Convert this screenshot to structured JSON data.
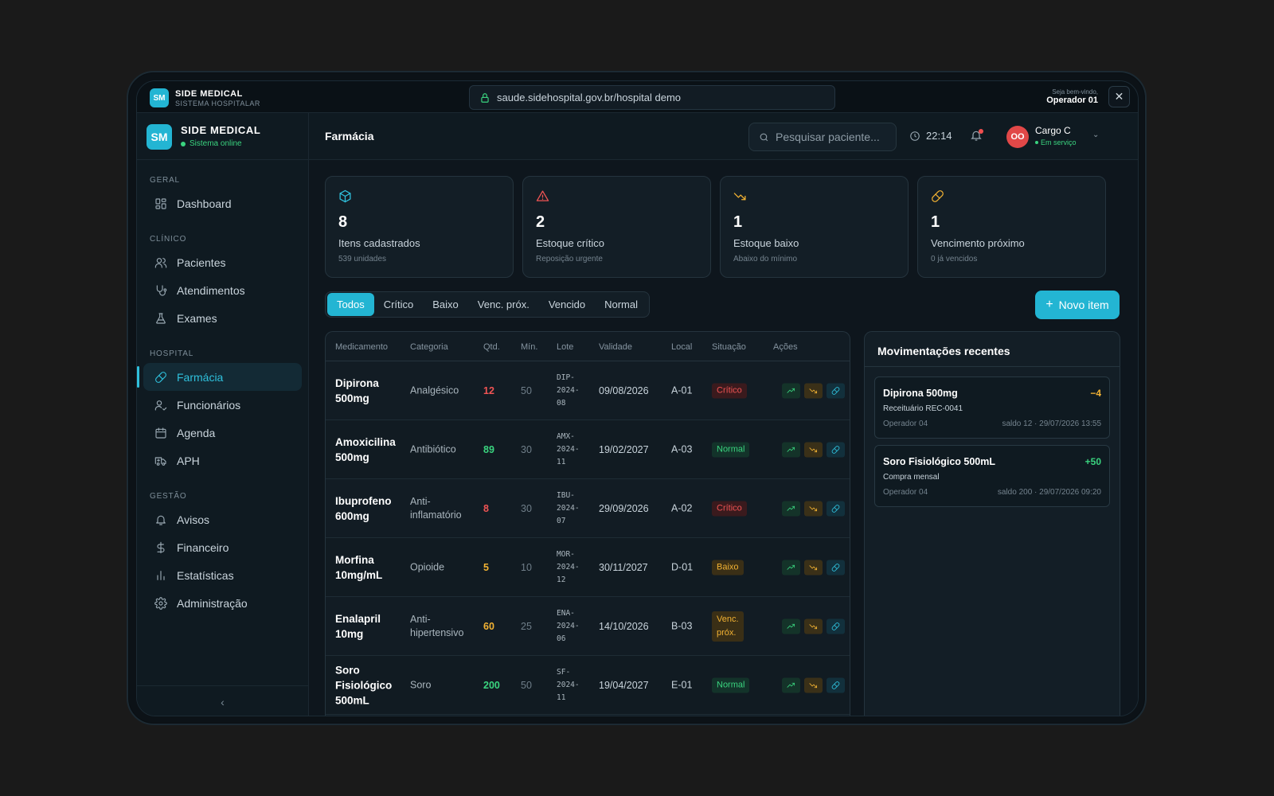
{
  "window": {
    "brand_name": "SIDE MEDICAL",
    "brand_sub": "SISTEMA HOSPITALAR",
    "logo": "SM",
    "url": "saude.sidehospital.gov.br/hospital demo",
    "welcome_label": "Seja bem-vindo,",
    "welcome_user": "Operador 01",
    "close_label": "✕"
  },
  "sidebar": {
    "logo": "SM",
    "brand": "SIDE MEDICAL",
    "status": "Sistema online",
    "collapse_label": "‹",
    "sections": {
      "geral": "GERAL",
      "clinico": "CLÍNICO",
      "hospital": "HOSPITAL",
      "gestao": "GESTÃO"
    },
    "items": {
      "dashboard": "Dashboard",
      "pacientes": "Pacientes",
      "atendimentos": "Atendimentos",
      "exames": "Exames",
      "farmacia": "Farmácia",
      "funcionarios": "Funcionários",
      "agenda": "Agenda",
      "aph": "APH",
      "avisos": "Avisos",
      "financeiro": "Financeiro",
      "estatisticas": "Estatísticas",
      "administracao": "Administração"
    },
    "active": "farmacia"
  },
  "header": {
    "title": "Farmácia",
    "search_placeholder": "Pesquisar paciente...",
    "time": "22:14",
    "avatar_initials": "OO",
    "user_name": "Cargo C",
    "user_status": "Em serviço"
  },
  "stats": [
    {
      "value": "8",
      "label": "Itens cadastrados",
      "sub": "539 unidades",
      "icon": "box-icon",
      "color": "#2fc0dc"
    },
    {
      "value": "2",
      "label": "Estoque crítico",
      "sub": "Reposição urgente",
      "icon": "alert-triangle-icon",
      "color": "#f05454"
    },
    {
      "value": "1",
      "label": "Estoque baixo",
      "sub": "Abaixo do mínimo",
      "icon": "trending-down-icon",
      "color": "#f2b233"
    },
    {
      "value": "1",
      "label": "Vencimento próximo",
      "sub": "0 já vencidos",
      "icon": "pill-icon",
      "color": "#f2b233"
    }
  ],
  "filters": {
    "tabs": [
      "Todos",
      "Crítico",
      "Baixo",
      "Venc. próx.",
      "Vencido",
      "Normal"
    ],
    "active_index": 0
  },
  "new_item_label": "Novo item",
  "table": {
    "columns": [
      "Medicamento",
      "Categoria",
      "Qtd.",
      "Mín.",
      "Lote",
      "Validade",
      "Local",
      "Situação",
      "Ações"
    ],
    "rows": [
      {
        "name": "Dipirona 500mg",
        "category": "Analgésico",
        "qty": "12",
        "min": "50",
        "lote": "DIP-2024-08",
        "validade": "09/08/2026",
        "local": "A-01",
        "status": "Crítico",
        "status_type": "critico"
      },
      {
        "name": "Amoxicilina 500mg",
        "category": "Antibiótico",
        "qty": "89",
        "min": "30",
        "lote": "AMX-2024-11",
        "validade": "19/02/2027",
        "local": "A-03",
        "status": "Normal",
        "status_type": "normal"
      },
      {
        "name": "Ibuprofeno 600mg",
        "category": "Anti-inflamatório",
        "qty": "8",
        "min": "30",
        "lote": "IBU-2024-07",
        "validade": "29/09/2026",
        "local": "A-02",
        "status": "Crítico",
        "status_type": "critico"
      },
      {
        "name": "Morfina 10mg/mL",
        "category": "Opioide",
        "qty": "5",
        "min": "10",
        "lote": "MOR-2024-12",
        "validade": "30/11/2027",
        "local": "D-01",
        "status": "Baixo",
        "status_type": "baixo"
      },
      {
        "name": "Enalapril 10mg",
        "category": "Anti-hipertensivo",
        "qty": "60",
        "min": "25",
        "lote": "ENA-2024-06",
        "validade": "14/10/2026",
        "local": "B-03",
        "status": "Venc. próx.",
        "status_type": "venc"
      },
      {
        "name": "Soro Fisiológico 500mL",
        "category": "Soro",
        "qty": "200",
        "min": "50",
        "lote": "SF-2024-11",
        "validade": "19/04/2027",
        "local": "E-01",
        "status": "Normal",
        "status_type": "normal"
      }
    ]
  },
  "movements": {
    "title": "Movimentações recentes",
    "items": [
      {
        "name": "Dipirona 500mg",
        "qty": "−4",
        "qty_type": "out",
        "desc": "Receituário REC-0041",
        "operator": "Operador 04",
        "balance": "saldo 12 · 29/07/2026 13:55"
      },
      {
        "name": "Soro Fisiológico 500mL",
        "qty": "+50",
        "qty_type": "in",
        "desc": "Compra mensal",
        "operator": "Operador 04",
        "balance": "saldo 200 · 29/07/2026 09:20"
      }
    ]
  },
  "colors": {
    "accent": "#23b5d3",
    "critico": "#f05454",
    "baixo": "#f2b233",
    "normal": "#3ad47f"
  }
}
